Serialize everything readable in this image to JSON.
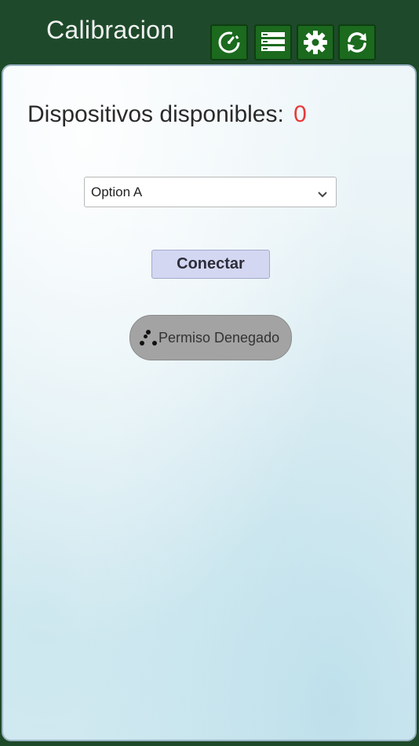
{
  "header": {
    "title": "Calibracion",
    "buttons": [
      {
        "icon": "speedometer-icon"
      },
      {
        "icon": "list-icon"
      },
      {
        "icon": "gear-icon"
      },
      {
        "icon": "refresh-icon"
      }
    ]
  },
  "devices": {
    "label": "Dispositivos disponibles:",
    "count": "0",
    "count_color": "#e83a3a"
  },
  "device_select": {
    "selected": "Option A"
  },
  "connect_button": {
    "label": "Conectar"
  },
  "toast": {
    "message": "Permiso Denegado"
  },
  "colors": {
    "header_bg": "#1e4a2b",
    "toolbar_button": "#1b6a1e",
    "connect_bg": "#d3d7f2"
  }
}
